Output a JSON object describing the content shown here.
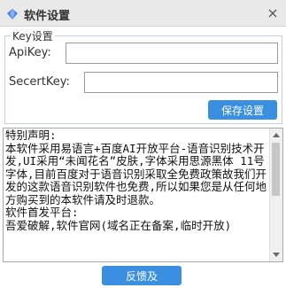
{
  "window": {
    "title": "软件设置",
    "app_icon": "diamond-icon",
    "close_icon": "close-icon"
  },
  "key_group": {
    "legend": "Key设置",
    "apikey_label": "ApiKey:",
    "apikey_value": "",
    "secretkey_label": "SecertKey:",
    "secretkey_value": "",
    "save_button": "保存设置"
  },
  "notice": {
    "text": "特别声明:\n本软件采用易语言+百度AI开放平台-语音识别技术开发,UI采用“未闻花名”皮肤,字体采用思源黑体 11号字体,目前百度对于语音识别采取全免费政策故我们开发的这款语音识别软件也免费,所以如果您是从任何地方购买到的本软件请及时退款。\n软件首发平台:\n吾爱破解,软件官网(域名正在备案,临时开放)"
  },
  "footer": {
    "feedback_button": "反馈及"
  },
  "colors": {
    "accent": "#3a8fe0",
    "titlebar": "#e9e9e9",
    "group_border": "#c4cfe0"
  }
}
